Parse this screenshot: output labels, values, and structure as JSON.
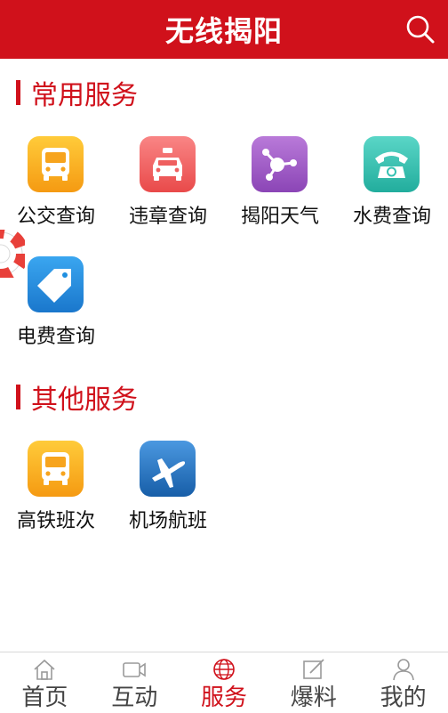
{
  "header": {
    "title": "无线揭阳"
  },
  "sections": {
    "common": {
      "title": "常用服务",
      "items": [
        {
          "label": "公交查询",
          "icon": "bus-icon",
          "color": "#f7a41d"
        },
        {
          "label": "违章查询",
          "icon": "car-icon",
          "color": "#ef5f5f"
        },
        {
          "label": "揭阳天气",
          "icon": "weather-icon",
          "color": "#9a55c3"
        },
        {
          "label": "水费查询",
          "icon": "telephone-icon",
          "color": "#35c1b2"
        },
        {
          "label": "电费查询",
          "icon": "tag-icon",
          "color": "#1f8fe0"
        }
      ]
    },
    "other": {
      "title": "其他服务",
      "items": [
        {
          "label": "高铁班次",
          "icon": "bus-icon",
          "color": "#f7a41d"
        },
        {
          "label": "机场航班",
          "icon": "airplane-icon",
          "color": "#1e6fc1"
        }
      ]
    }
  },
  "tabbar": {
    "items": [
      {
        "label": "首页",
        "icon": "home-icon"
      },
      {
        "label": "互动",
        "icon": "video-icon"
      },
      {
        "label": "服务",
        "icon": "globe-icon",
        "active": true
      },
      {
        "label": "爆料",
        "icon": "edit-icon"
      },
      {
        "label": "我的",
        "icon": "user-icon"
      }
    ]
  },
  "colors": {
    "brand": "#d0111b"
  }
}
